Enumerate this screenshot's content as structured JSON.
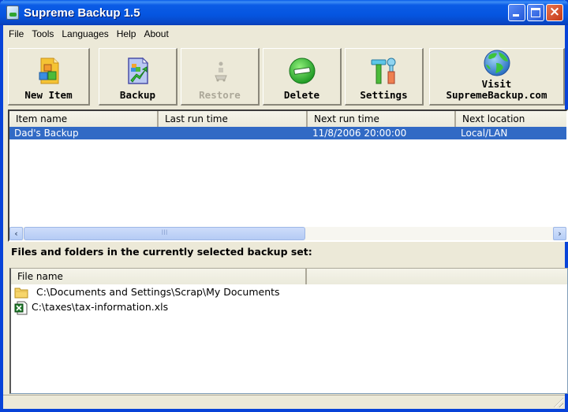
{
  "window": {
    "title": "Supreme Backup 1.5",
    "controls": {
      "minimize": "minimize",
      "maximize": "maximize",
      "close": "×"
    }
  },
  "menu": [
    "File",
    "Tools",
    "Languages",
    "Help",
    "About"
  ],
  "toolbar": {
    "buttons": [
      {
        "label": "New Item",
        "icon": "new-item-icon",
        "enabled": true
      },
      {
        "label": "Backup",
        "icon": "backup-icon",
        "enabled": true
      },
      {
        "label": "Restore",
        "icon": "restore-icon",
        "enabled": false
      },
      {
        "label": "Delete",
        "icon": "delete-icon",
        "enabled": true
      },
      {
        "label": "Settings",
        "icon": "settings-icon",
        "enabled": true
      },
      {
        "label_line1": "Visit",
        "label_line2": "SupremeBackup.com",
        "icon": "globe-icon",
        "enabled": true
      }
    ]
  },
  "items_table": {
    "columns": [
      "Item name",
      "Last run time",
      "Next run time",
      "Next location"
    ],
    "rows": [
      {
        "item_name": "Dad's Backup",
        "last_run_time": "",
        "next_run_time": "11/8/2006 20:00:00",
        "next_location": "Local/LAN",
        "selected": true
      }
    ],
    "scroll_thumb_glyph": "III"
  },
  "files_section": {
    "label": "Files and folders in the currently selected backup set:",
    "columns": [
      "File name"
    ],
    "rows": [
      {
        "path": "C:\\Documents and Settings\\Scrap\\My Documents",
        "type": "folder"
      },
      {
        "path": "C:\\taxes\\tax-information.xls",
        "type": "excel-file"
      }
    ]
  },
  "colors": {
    "title_bar": "#0555e0",
    "selection": "#316ac5",
    "window_bg": "#ece9d8",
    "disabled_text": "#aca899"
  }
}
